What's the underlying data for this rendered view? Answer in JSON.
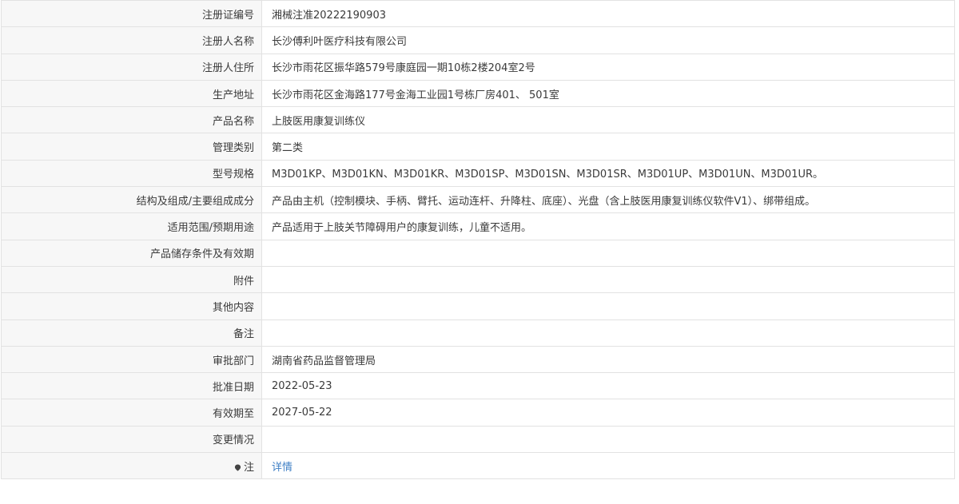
{
  "rows": [
    {
      "label": "注册证编号",
      "value": "湘械注准20222190903"
    },
    {
      "label": "注册人名称",
      "value": "长沙傅利叶医疗科技有限公司"
    },
    {
      "label": "注册人住所",
      "value": "长沙市雨花区振华路579号康庭园一期10栋2楼204室2号"
    },
    {
      "label": "生产地址",
      "value": "长沙市雨花区金海路177号金海工业园1号栋厂房401、 501室"
    },
    {
      "label": "产品名称",
      "value": "上肢医用康复训练仪"
    },
    {
      "label": "管理类别",
      "value": "第二类"
    },
    {
      "label": "型号规格",
      "value": "M3D01KP、M3D01KN、M3D01KR、M3D01SP、M3D01SN、M3D01SR、M3D01UP、M3D01UN、M3D01UR。"
    },
    {
      "label": "结构及组成/主要组成成分",
      "value": "产品由主机（控制模块、手柄、臂托、运动连杆、升降柱、底座）、光盘（含上肢医用康复训练仪软件V1）、绑带组成。"
    },
    {
      "label": "适用范围/预期用途",
      "value": "产品适用于上肢关节障碍用户的康复训练，儿童不适用。"
    },
    {
      "label": "产品储存条件及有效期",
      "value": ""
    },
    {
      "label": "附件",
      "value": ""
    },
    {
      "label": "其他内容",
      "value": ""
    },
    {
      "label": "备注",
      "value": ""
    },
    {
      "label": "审批部门",
      "value": "湖南省药品监督管理局"
    },
    {
      "label": "批准日期",
      "value": "2022-05-23"
    },
    {
      "label": "有效期至",
      "value": "2027-05-22"
    },
    {
      "label": "变更情况",
      "value": ""
    }
  ],
  "note": {
    "label": "注",
    "link_text": "详情",
    "icon": "location-pin-icon"
  }
}
